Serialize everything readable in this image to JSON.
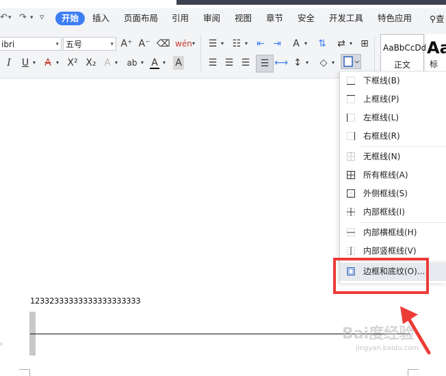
{
  "quick_access": {
    "undo_icon": "undo-icon",
    "redo_icon": "redo-icon",
    "more": "▿"
  },
  "menu": {
    "tabs": [
      "开始",
      "插入",
      "页面布局",
      "引用",
      "审阅",
      "视图",
      "章节",
      "安全",
      "开发工具",
      "特色应用"
    ],
    "active_tab": "开始",
    "search_label": "查"
  },
  "ribbon": {
    "font_name": "ibri",
    "font_size": "五号",
    "styles": [
      {
        "sample": "AaBbCcDd",
        "name": "正文"
      },
      {
        "sample": "Aa",
        "name": "标"
      }
    ]
  },
  "border_menu": {
    "items": [
      {
        "label": "下框线(B)",
        "icon": "bottom-border-icon"
      },
      {
        "label": "上框线(P)",
        "icon": "top-border-icon"
      },
      {
        "label": "左框线(L)",
        "icon": "left-border-icon"
      },
      {
        "label": "右框线(R)",
        "icon": "right-border-icon"
      },
      {
        "label": "无框线(N)",
        "icon": "no-border-icon"
      },
      {
        "label": "所有框线(A)",
        "icon": "all-borders-icon"
      },
      {
        "label": "外侧框线(S)",
        "icon": "outside-borders-icon"
      },
      {
        "label": "内部框线(I)",
        "icon": "inside-borders-icon"
      },
      {
        "label": "内部横框线(H)",
        "icon": "inside-horizontal-border-icon"
      },
      {
        "label": "内部竖框线(V)",
        "icon": "inside-vertical-border-icon"
      },
      {
        "label": "边框和底纹(O)...",
        "icon": "borders-and-shading-icon"
      }
    ]
  },
  "document": {
    "text": "12332333333333333333333"
  },
  "watermark": {
    "logo": "Bai度经验",
    "url": "jingyan.baidu.com"
  },
  "colors": {
    "accent": "#3d7ef5",
    "highlight": "#ec3b36"
  }
}
